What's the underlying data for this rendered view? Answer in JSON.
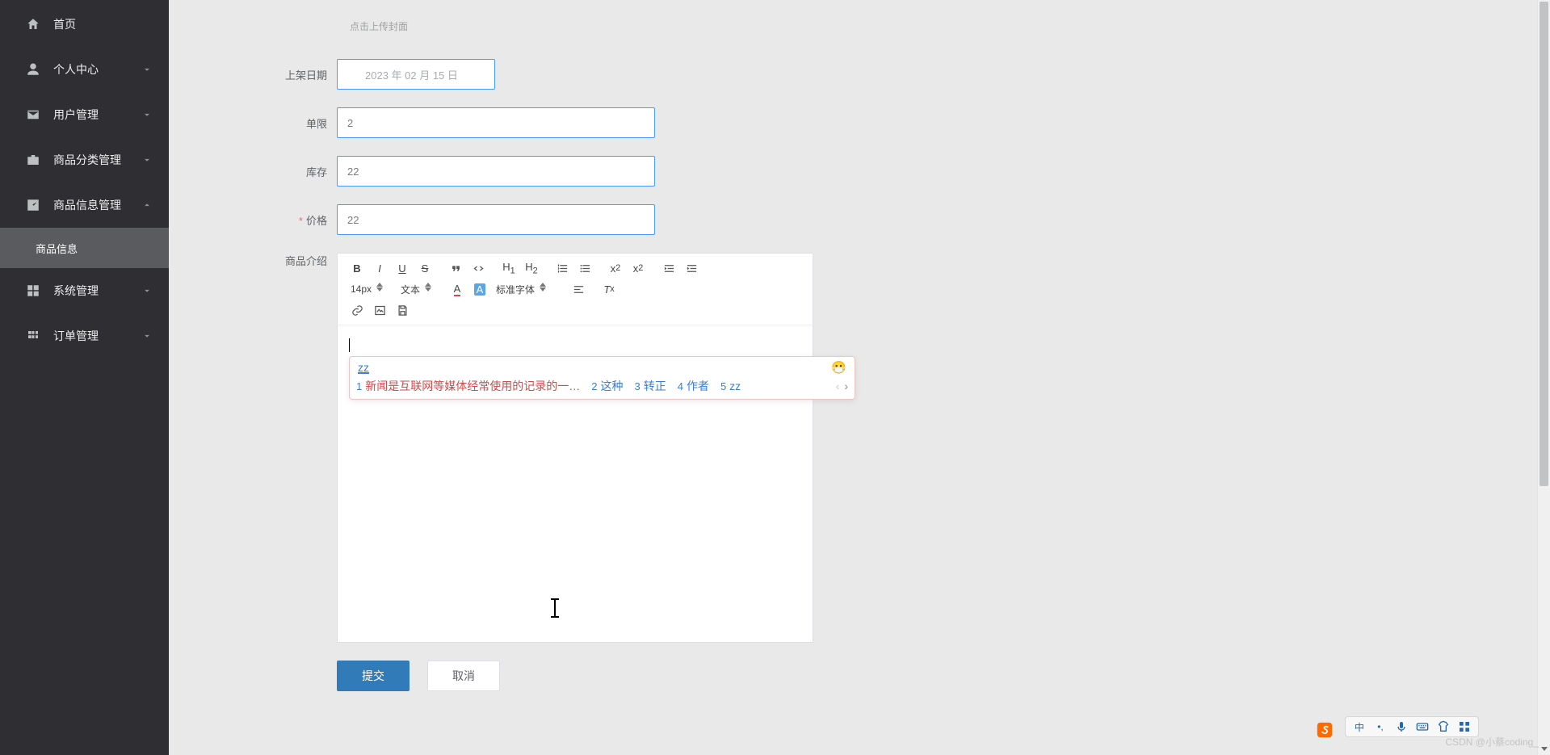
{
  "sidebar": {
    "items": [
      {
        "label": "首页",
        "expandable": false
      },
      {
        "label": "个人中心",
        "expandable": true
      },
      {
        "label": "用户管理",
        "expandable": true
      },
      {
        "label": "商品分类管理",
        "expandable": true
      },
      {
        "label": "商品信息管理",
        "expandable": true,
        "open": true
      },
      {
        "label": "系统管理",
        "expandable": true
      },
      {
        "label": "订单管理",
        "expandable": true
      }
    ],
    "sub_item": "商品信息"
  },
  "form": {
    "upload_hint": "点击上传封面",
    "labels": {
      "date": "上架日期",
      "limit": "单限",
      "stock": "库存",
      "price": "价格",
      "desc": "商品介绍"
    },
    "values": {
      "date": "2023 年 02 月 15 日",
      "limit": "2",
      "stock": "22",
      "price": "22"
    },
    "required": {
      "price": true
    }
  },
  "editor": {
    "toolbar": {
      "font_size": "14px",
      "block": "文本",
      "font_family": "标准字体"
    }
  },
  "ime": {
    "typed": "zz",
    "emoji": "😷",
    "candidates": [
      {
        "n": "1",
        "txt": "新闻是互联网等媒体经常使用的记录的一…"
      },
      {
        "n": "2",
        "txt": "这种"
      },
      {
        "n": "3",
        "txt": "转正"
      },
      {
        "n": "4",
        "txt": "作者"
      },
      {
        "n": "5",
        "txt": "zz"
      }
    ],
    "nav_prev": "‹",
    "nav_next": "›"
  },
  "buttons": {
    "submit": "提交",
    "cancel": "取消"
  },
  "tray": {
    "lang": "中",
    "punc": "•,"
  },
  "watermark": "CSDN @小蔡coding_"
}
